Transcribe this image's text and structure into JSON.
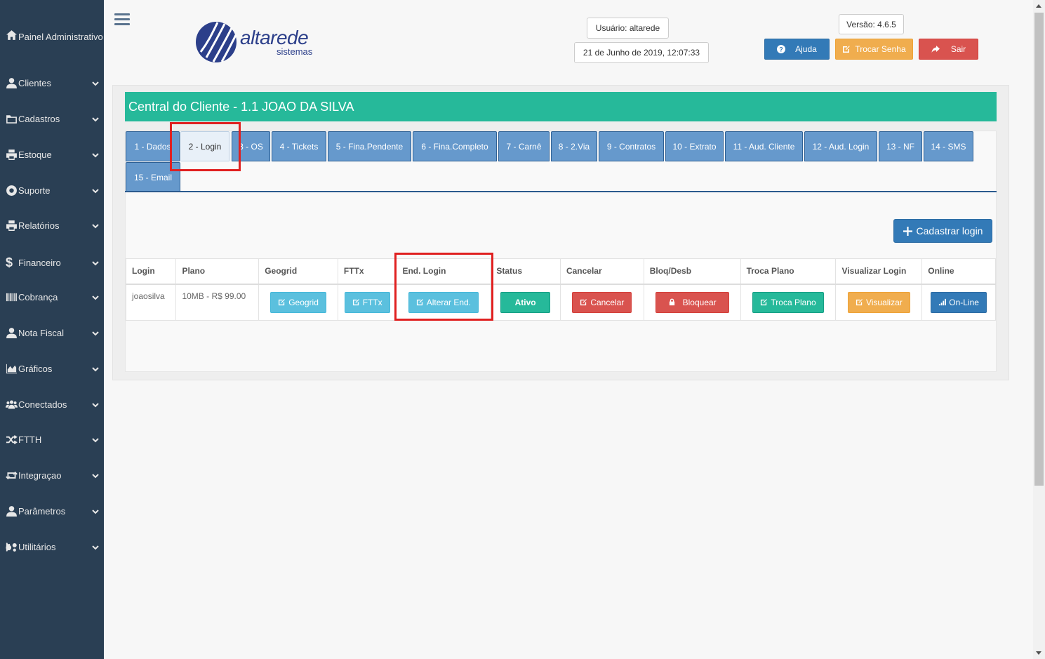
{
  "sidebar": {
    "items": [
      {
        "label": "Painel Administrativo",
        "icon": "home-icon"
      },
      {
        "label": "Clientes",
        "icon": "user-icon"
      },
      {
        "label": "Cadastros",
        "icon": "folder-icon"
      },
      {
        "label": "Estoque",
        "icon": "print-icon"
      },
      {
        "label": "Suporte",
        "icon": "lifebuoy-icon"
      },
      {
        "label": "Relatórios",
        "icon": "print-icon"
      },
      {
        "label": "Financeiro",
        "icon": "dollar-icon"
      },
      {
        "label": "Cobrança",
        "icon": "barcode-icon"
      },
      {
        "label": "Nota Fiscal",
        "icon": "user-icon"
      },
      {
        "label": "Gráficos",
        "icon": "area-chart-icon"
      },
      {
        "label": "Conectados",
        "icon": "users-icon"
      },
      {
        "label": "FTTH",
        "icon": "random-icon"
      },
      {
        "label": "Integraçao",
        "icon": "retweet-icon"
      },
      {
        "label": "Parâmetros",
        "icon": "user-icon"
      },
      {
        "label": "Utilitários",
        "icon": "cogs-icon"
      }
    ]
  },
  "header": {
    "logo_text": "altarede",
    "logo_sub": "sistemas",
    "user": "Usuário: altarede",
    "datetime": "21 de Junho de 2019, 12:07:33",
    "version": "Versão: 4.6.5",
    "help_label": "Ajuda",
    "change_password_label": "Trocar Senha",
    "logout_label": "Sair"
  },
  "page": {
    "title": "Central do Cliente - 1.1 JOAO DA SILVA",
    "tabs": [
      "1 - Dados",
      "2 - Login",
      "3 - OS",
      "4 - Tickets",
      "5 - Fina.Pendente",
      "6 - Fina.Completo",
      "7 - Carnê",
      "8 - 2.Via",
      "9 - Contratos",
      "10 - Extrato",
      "11 - Aud. Cliente",
      "12 - Aud. Login",
      "13 - NF",
      "14 - SMS",
      "15 - Email"
    ],
    "active_tab": "2 - Login",
    "add_login_label": "Cadastrar login"
  },
  "table": {
    "headers": [
      "Login",
      "Plano",
      "Geogrid",
      "FTTx",
      "End. Login",
      "Status",
      "Cancelar",
      "Bloq/Desb",
      "Troca Plano",
      "Visualizar Login",
      "Online"
    ],
    "row": {
      "login": "joaosilva",
      "plano": "10MB - R$ 99.00",
      "geogrid": "Geogrid",
      "fttx": "FTTx",
      "end_login": "Alterar End.",
      "status": "Ativo",
      "cancelar": "Cancelar",
      "bloq": "Bloquear",
      "troca_plano": "Troca Plano",
      "visualizar": "Visualizar",
      "online": "On-Line"
    }
  },
  "colors": {
    "sidebar": "#2a3f54",
    "title_bar": "#26b99a",
    "tab": "#6699cc",
    "highlight": "#e02020"
  }
}
